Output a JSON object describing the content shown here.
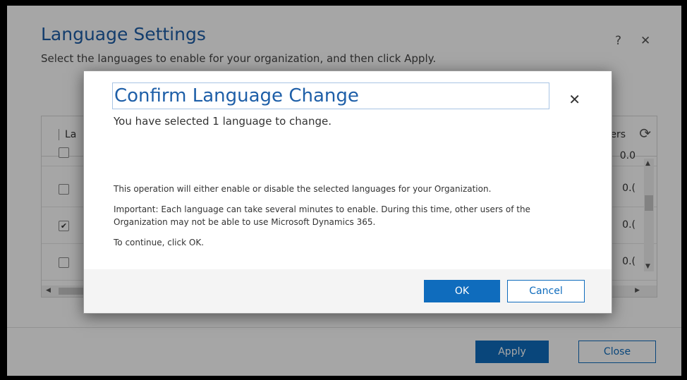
{
  "page": {
    "title": "Language Settings",
    "subtitle": "Select the languages to enable for your organization, and then click Apply.",
    "help_icon": "?",
    "close_icon": "✕"
  },
  "grid": {
    "column_language": "La",
    "column_users": "ers",
    "refresh_icon": "⟳",
    "rows": [
      {
        "checked": false,
        "value": "0.0"
      },
      {
        "checked": false,
        "value": "0.("
      },
      {
        "checked": true,
        "value": "0.("
      },
      {
        "checked": false,
        "value": "0.("
      }
    ]
  },
  "footer": {
    "apply_label": "Apply",
    "close_label": "Close"
  },
  "dialog": {
    "title": "Confirm Language Change",
    "subtitle": "You have selected 1 language to change.",
    "close_icon": "✕",
    "body_line1": "This operation will either enable or disable the selected languages for your Organization.",
    "body_line2": "Important: Each language can take several minutes to enable. During this time, other users of the Organization may not be able to use Microsoft Dynamics 365.",
    "body_line3": "To continue, click OK.",
    "ok_label": "OK",
    "cancel_label": "Cancel"
  },
  "colors": {
    "accent": "#0f6cbd",
    "title_blue": "#1e5fa8"
  }
}
